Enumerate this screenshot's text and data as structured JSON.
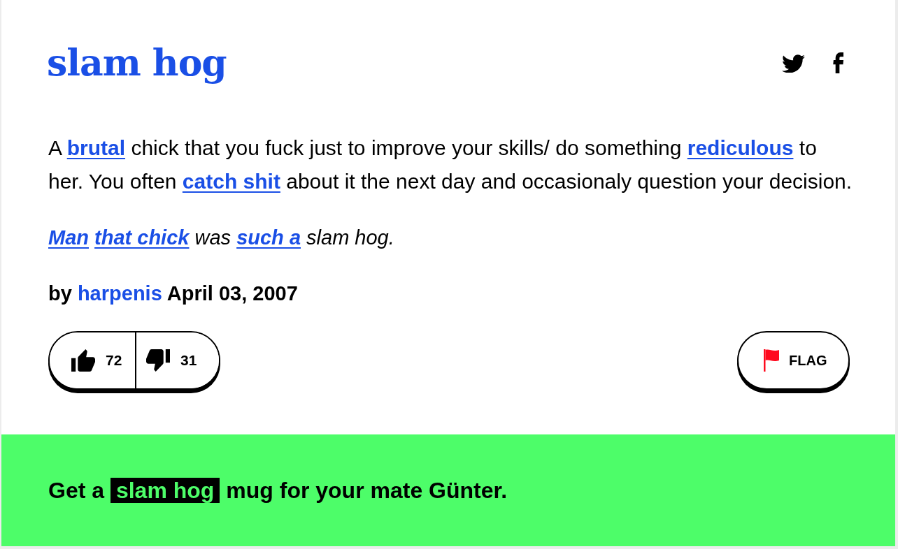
{
  "entry": {
    "title": "slam hog",
    "meaning": [
      {
        "kind": "text",
        "text": "A"
      },
      {
        "kind": "link",
        "text": "brutal"
      },
      {
        "kind": "text",
        "text": "chick that you fuck just to improve your skills/ do something"
      },
      {
        "kind": "link",
        "text": "rediculous"
      },
      {
        "kind": "text",
        "text": "to her. You often"
      },
      {
        "kind": "link",
        "text": "catch shit"
      },
      {
        "kind": "text",
        "text": "about it the next day and occasionaly question your decision."
      }
    ],
    "example": [
      {
        "kind": "link",
        "text": "Man"
      },
      {
        "kind": "link",
        "text": "that chick"
      },
      {
        "kind": "text",
        "text": "was"
      },
      {
        "kind": "link",
        "text": "such a"
      },
      {
        "kind": "text",
        "text": "slam hog."
      }
    ],
    "byline": {
      "prefix": "by",
      "author": "harpenis",
      "date": "April 03, 2007"
    },
    "votes": {
      "up": "72",
      "down": "31"
    },
    "flag": {
      "label": "FLAG"
    }
  },
  "promo": {
    "segments": [
      {
        "kind": "text",
        "text": "Get a"
      },
      {
        "kind": "highlight",
        "text": "slam hog"
      },
      {
        "kind": "text",
        "text": "mug for your mate Günter."
      }
    ]
  }
}
